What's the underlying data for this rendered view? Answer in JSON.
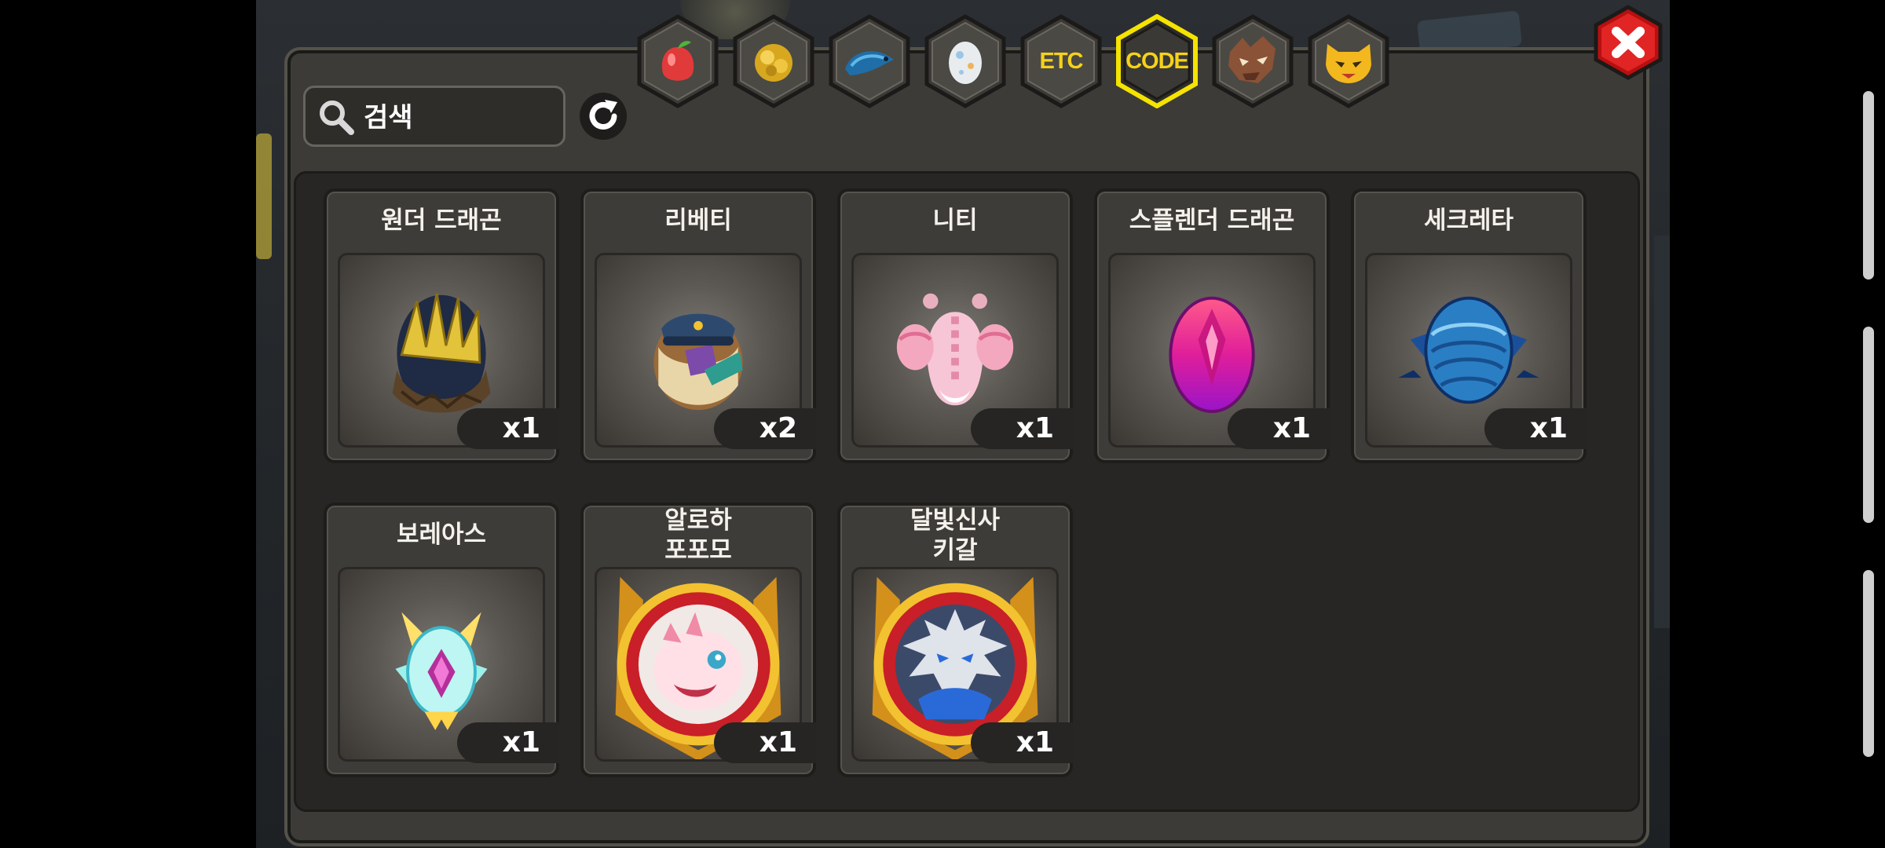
{
  "search": {
    "placeholder": "검색",
    "value": ""
  },
  "tabs": [
    {
      "name": "fruit",
      "icon": "fruit-icon"
    },
    {
      "name": "gold",
      "icon": "gold-icon"
    },
    {
      "name": "fish",
      "icon": "fish-icon"
    },
    {
      "name": "egg",
      "icon": "egg-icon"
    },
    {
      "name": "etc",
      "label": "ETC"
    },
    {
      "name": "code",
      "label": "CODE",
      "active": true
    },
    {
      "name": "dragon-head",
      "icon": "dragon-head-icon"
    },
    {
      "name": "demon-mask",
      "icon": "demon-mask-icon"
    }
  ],
  "items": [
    {
      "name": "원더 드래곤",
      "qty": "x1",
      "icon": "wonder-dragon-egg-icon"
    },
    {
      "name": "리베티",
      "qty": "x2",
      "icon": "libety-icon"
    },
    {
      "name": "니티",
      "qty": "x1",
      "icon": "niti-icon"
    },
    {
      "name": "스플렌더 드래곤",
      "qty": "x1",
      "icon": "splendor-dragon-egg-icon"
    },
    {
      "name": "세크레타",
      "qty": "x1",
      "icon": "secreta-egg-icon"
    },
    {
      "name": "보레아스",
      "qty": "x1",
      "icon": "boreas-egg-icon"
    },
    {
      "name": "알로하\n포포모",
      "qty": "x1",
      "icon": "aloha-popomo-icon"
    },
    {
      "name": "달빛신사\n키갈",
      "qty": "x1",
      "icon": "moonlight-kigal-icon"
    }
  ],
  "colors": {
    "active_tab_border": "#f5e300",
    "tab_label_fill": "#f5d21a",
    "close_button": "#d61a1a"
  }
}
